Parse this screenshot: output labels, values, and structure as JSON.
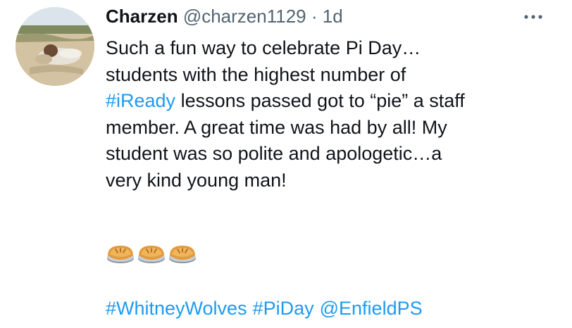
{
  "tweet": {
    "author": {
      "name": "Charzen",
      "handle": "@charzen1129",
      "separator": "·",
      "time": "1d"
    },
    "more_icon": "more-horizontal-icon",
    "lines": [
      [
        {
          "text": "Such a fun way to celebrate Pi Day…"
        }
      ],
      [
        {
          "text": "students with the highest number of"
        }
      ],
      [
        {
          "text": "#iReady",
          "link": true
        },
        {
          "text": " lessons passed got to “pie” a staff"
        }
      ],
      [
        {
          "text": "member. A great time was had by all! My"
        }
      ],
      [
        {
          "text": "student was so polite and apologetic…a"
        }
      ],
      [
        {
          "text": "very kind young man!"
        }
      ]
    ],
    "emojis": [
      "pie-emoji",
      "pie-emoji",
      "pie-emoji"
    ],
    "tags": [
      "#WhitneyWolves",
      "#PiDay",
      "@EnfieldPS"
    ],
    "colors": {
      "text": "#0f1419",
      "secondary": "#536471",
      "link": "#1d9bf0"
    }
  }
}
